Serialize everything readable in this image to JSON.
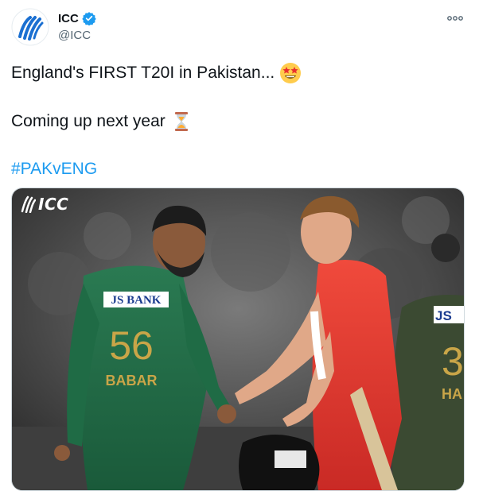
{
  "account": {
    "display_name": "ICC",
    "handle": "@ICC",
    "avatar_icon": "icc-logo-icon",
    "verified_icon": "verified-badge-icon"
  },
  "tweet": {
    "line1": "England's FIRST T20I in Pakistan...",
    "line1_emoji": "star-struck-emoji",
    "line2": "Coming up next year",
    "line2_emoji": "hourglass-emoji",
    "hashtag": "#PAKvENG"
  },
  "media": {
    "watermark": "ICC",
    "jersey_sponsor": "JS BANK",
    "jersey_number": "56",
    "jersey_name": "BABAR",
    "bg_jersey_sponsor": "JS",
    "bg_jersey_number": "3",
    "bg_jersey_name": "HA"
  },
  "colors": {
    "accent": "#1d9bf0",
    "pakistan_green": "#1f6b45",
    "england_red": "#e8322f"
  }
}
